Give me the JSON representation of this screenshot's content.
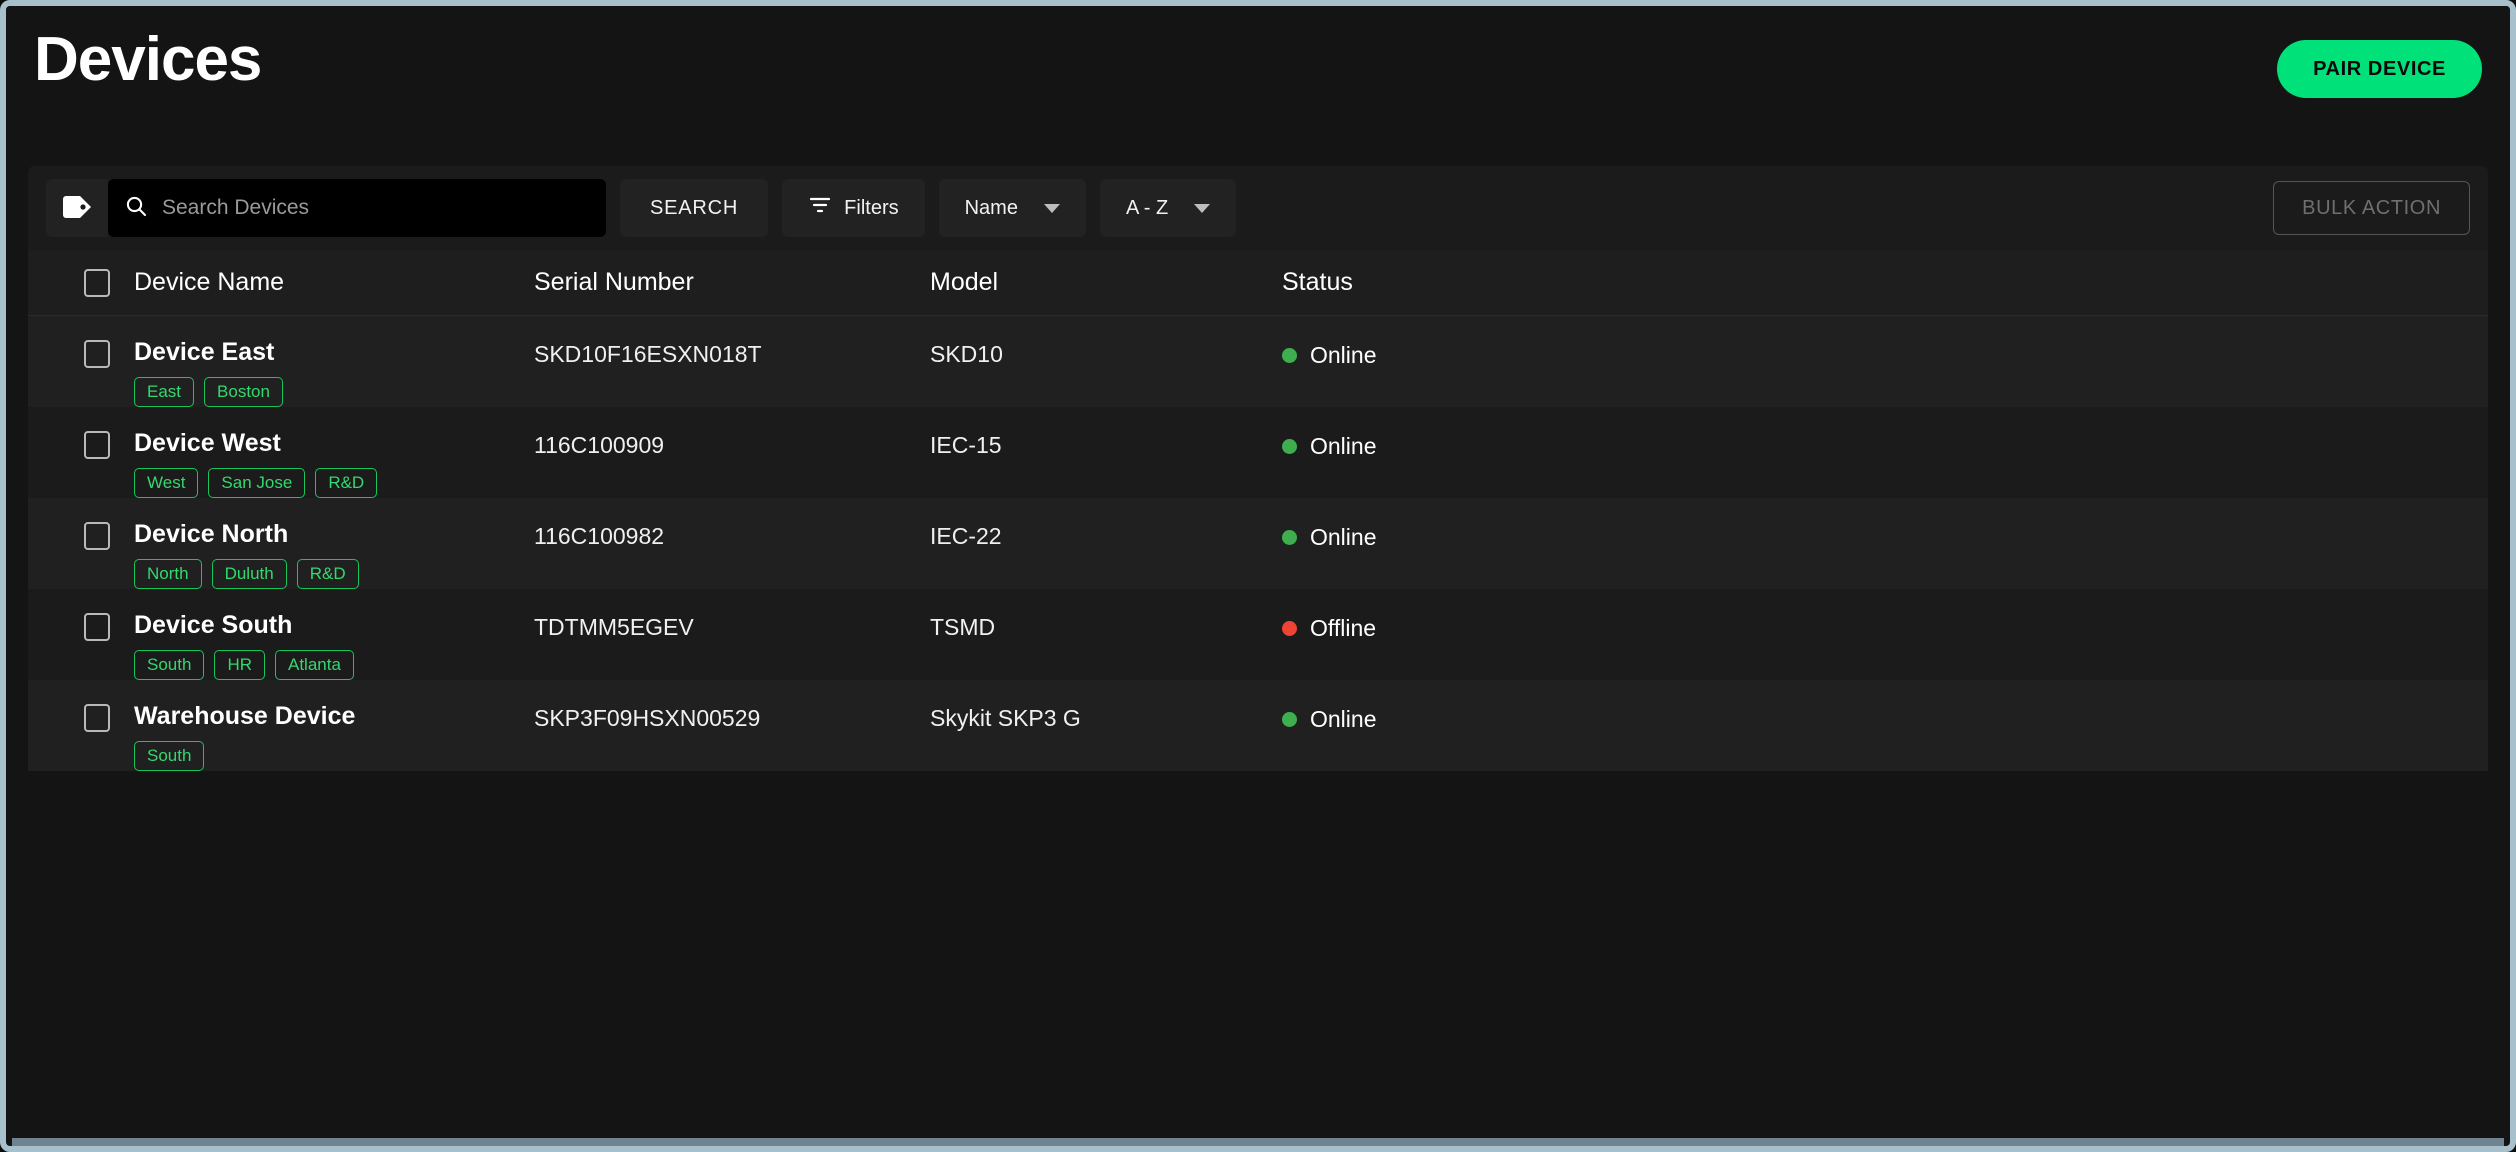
{
  "header": {
    "title": "Devices",
    "pair_device_label": "PAIR DEVICE"
  },
  "toolbar": {
    "tag_icon": "tag-icon",
    "search_icon": "search-icon",
    "search_placeholder": "Search Devices",
    "search_value": "",
    "search_button_label": "SEARCH",
    "filters_label": "Filters",
    "filters_icon": "filter-icon",
    "sort_field_label": "Name",
    "sort_order_label": "A - Z",
    "bulk_action_label": "BULK ACTION"
  },
  "table": {
    "columns": [
      "Device Name",
      "Serial Number",
      "Model",
      "Status"
    ],
    "rows": [
      {
        "name": "Device East",
        "serial": "SKD10F16ESXN018T",
        "model": "SKD10",
        "status": "Online",
        "status_color": "#3fae4f",
        "tags": [
          "East",
          "Boston"
        ]
      },
      {
        "name": "Device West",
        "serial": "116C100909",
        "model": "IEC-15",
        "status": "Online",
        "status_color": "#3fae4f",
        "tags": [
          "West",
          "San Jose",
          "R&D"
        ]
      },
      {
        "name": "Device North",
        "serial": "116C100982",
        "model": "IEC-22",
        "status": "Online",
        "status_color": "#3fae4f",
        "tags": [
          "North",
          "Duluth",
          "R&D"
        ]
      },
      {
        "name": "Device South",
        "serial": "TDTMM5EGEV",
        "model": "TSMD",
        "status": "Offline",
        "status_color": "#ef4434",
        "tags": [
          "South",
          "HR",
          "Atlanta"
        ]
      },
      {
        "name": "Warehouse Device",
        "serial": "SKP3F09HSXN00529",
        "model": "Skykit SKP3 G",
        "status": "Online",
        "status_color": "#3fae4f",
        "tags": [
          "South"
        ]
      }
    ]
  },
  "theme": {
    "accent_green": "#00e17a",
    "tag_green": "#34d86f",
    "online_green": "#3fae4f",
    "offline_red": "#ef4434",
    "background": "#141414"
  }
}
